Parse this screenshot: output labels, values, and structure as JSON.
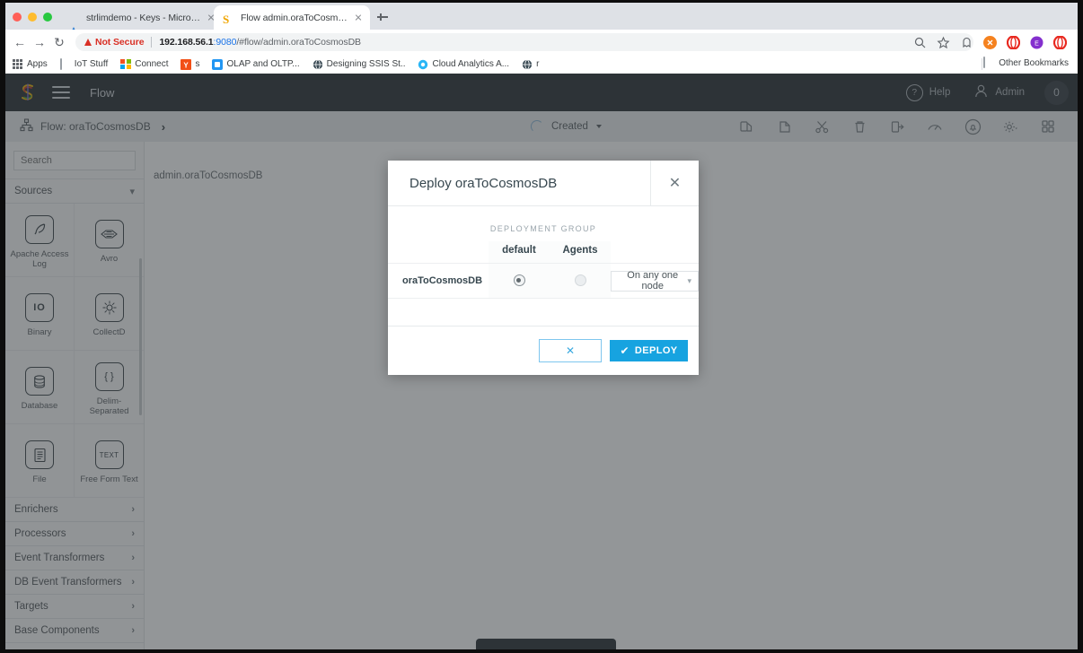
{
  "browser": {
    "tabs": [
      {
        "title": "strlimdemo - Keys - Microsoft ",
        "icon": "azure-icon",
        "active": false
      },
      {
        "title": "Flow admin.oraToCosmosDB",
        "icon": "striim-icon",
        "active": true
      }
    ],
    "new_tab_label": "+",
    "nav": {
      "back": "←",
      "forward": "→",
      "reload": "↻"
    },
    "omnibox": {
      "security_label": "Not Secure",
      "url_host": "192.168.56.1",
      "url_port": ":9080",
      "url_path": "/#flow/admin.oraToCosmosDB"
    },
    "bookmarks": [
      {
        "label": "Apps",
        "icon": "apps-grid-icon"
      },
      {
        "label": "IoT Stuff",
        "icon": "folder-icon"
      },
      {
        "label": "Connect",
        "icon": "microsoft-icon"
      },
      {
        "label": "s",
        "icon": "yahoo-icon"
      },
      {
        "label": "OLAP and OLTP...",
        "icon": "blue-doc-icon"
      },
      {
        "label": "Designing SSIS St..",
        "icon": "globe-icon"
      },
      {
        "label": "Cloud Analytics A...",
        "icon": "cyan-circle-icon"
      },
      {
        "label": "r",
        "icon": "globe-icon"
      }
    ],
    "other_bookmarks": {
      "label": "Other Bookmarks",
      "icon": "folder-icon"
    }
  },
  "app": {
    "appbar": {
      "logo": "striim-logo",
      "menu_icon": "hamburger-icon",
      "title": "Flow",
      "help_label": "Help",
      "help_icon": "question-circle-icon",
      "user_label": "Admin",
      "user_icon": "person-icon",
      "badge_count": "0"
    },
    "breadcrumb": {
      "icon": "flow-node-icon",
      "label": "Flow: oraToCosmosDB",
      "chevron": "›"
    },
    "status": {
      "spinner": "loading-spinner",
      "label": "Created",
      "caret": "chevron-down-icon"
    },
    "toolbar_icons": [
      {
        "name": "copy-icon"
      },
      {
        "name": "paste-icon"
      },
      {
        "name": "cut-icon"
      },
      {
        "name": "delete-icon"
      },
      {
        "name": "export-icon"
      },
      {
        "name": "monitor-gauge-icon"
      },
      {
        "name": "alert-bell-icon"
      },
      {
        "name": "settings-gear-icon"
      },
      {
        "name": "grid-view-icon"
      }
    ],
    "sidebar": {
      "search_placeholder": "Search",
      "sections": [
        {
          "label": "Sources",
          "expanded": true
        },
        {
          "label": "Enrichers",
          "expanded": false
        },
        {
          "label": "Processors",
          "expanded": false
        },
        {
          "label": "Event Transformers",
          "expanded": false
        },
        {
          "label": "DB Event Transformers",
          "expanded": false
        },
        {
          "label": "Targets",
          "expanded": false
        },
        {
          "label": "Base Components",
          "expanded": false
        }
      ],
      "source_items": [
        {
          "label": "Apache Access Log",
          "icon": "feather-quill-icon",
          "glyph": "✒"
        },
        {
          "label": "Avro",
          "icon": "avro-icon",
          "glyph": "▲"
        },
        {
          "label": "Binary",
          "icon": "binary-icon",
          "glyph": "IO"
        },
        {
          "label": "CollectD",
          "icon": "collectd-icon",
          "glyph": "☀"
        },
        {
          "label": "Database",
          "icon": "database-icon",
          "glyph": "⌸"
        },
        {
          "label": "Delim-Separated",
          "icon": "delimited-icon",
          "glyph": "{ }"
        },
        {
          "label": "File",
          "icon": "file-icon",
          "glyph": "☰"
        },
        {
          "label": "Free Form Text",
          "icon": "text-icon",
          "glyph": "TEXT"
        }
      ]
    },
    "canvas": {
      "flow_label": "admin.oraToCosmosDB"
    }
  },
  "modal": {
    "title": "Deploy oraToCosmosDB",
    "close_icon": "close-icon",
    "deployment_group_label": "DEPLOYMENT GROUP",
    "columns": [
      "default",
      "Agents"
    ],
    "rows": [
      {
        "name": "oraToCosmosDB",
        "default_selected": true,
        "agents_selected": false,
        "node_option": "On any one node",
        "node_caret": "chevron-down-icon"
      }
    ],
    "cancel_label": "✕",
    "deploy_label": "DEPLOY",
    "deploy_check": "✔"
  },
  "colors": {
    "accent": "#17a3e0",
    "appbar_bg": "#2b3035",
    "crumbbar_bg": "#ebedef",
    "warning_red": "#d93025",
    "link_blue": "#1a73e8"
  }
}
